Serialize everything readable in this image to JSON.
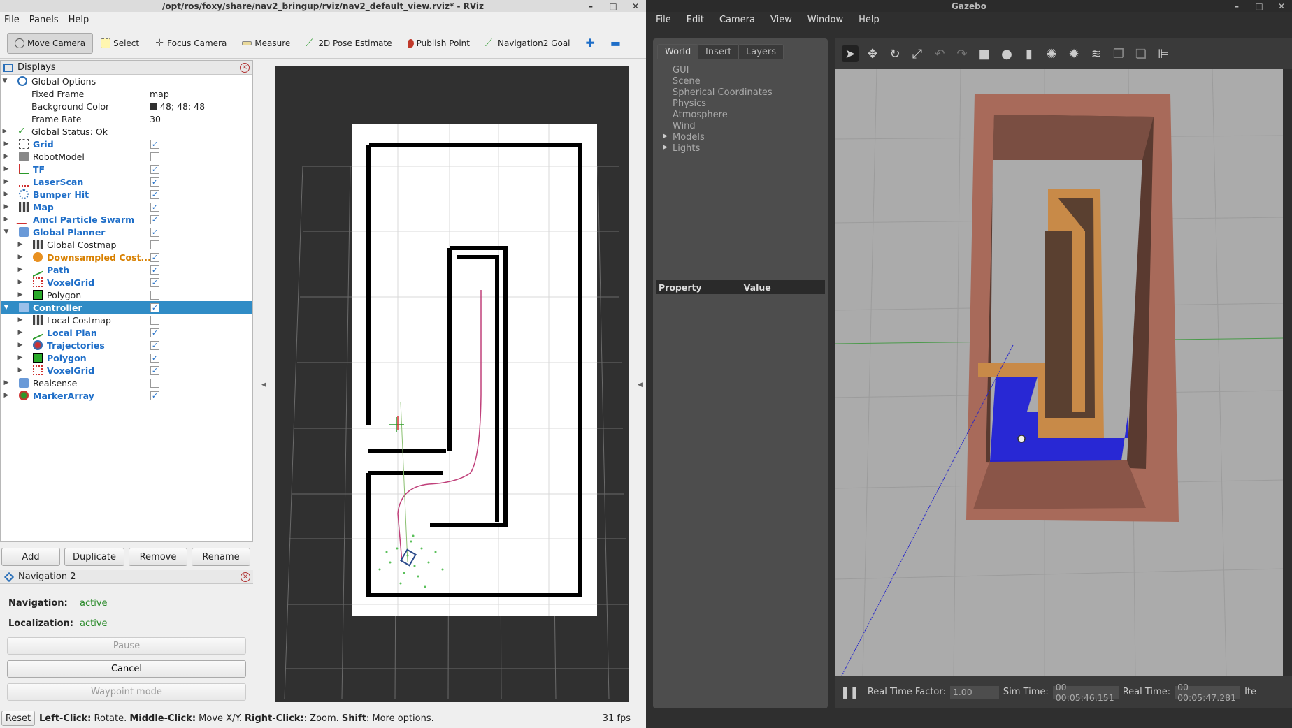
{
  "rviz": {
    "title": "/opt/ros/foxy/share/nav2_bringup/rviz/nav2_default_view.rviz* - RViz",
    "menu": [
      "File",
      "Panels",
      "Help"
    ],
    "toolbar": {
      "move_camera": "Move Camera",
      "select": "Select",
      "focus_camera": "Focus Camera",
      "measure": "Measure",
      "pose_estimate": "2D Pose Estimate",
      "publish_point": "Publish Point",
      "nav2_goal": "Navigation2 Goal"
    },
    "displays": {
      "title": "Displays",
      "global_options": "Global Options",
      "fixed_frame": {
        "label": "Fixed Frame",
        "value": "map"
      },
      "background_color": {
        "label": "Background Color",
        "value": "48; 48; 48"
      },
      "frame_rate": {
        "label": "Frame Rate",
        "value": "30"
      },
      "global_status": "Global Status: Ok",
      "items": [
        {
          "label": "Grid",
          "checked": true
        },
        {
          "label": "RobotModel",
          "checked": false
        },
        {
          "label": "TF",
          "checked": true
        },
        {
          "label": "LaserScan",
          "checked": true
        },
        {
          "label": "Bumper Hit",
          "checked": true
        },
        {
          "label": "Map",
          "checked": true
        },
        {
          "label": "Amcl Particle Swarm",
          "checked": true
        },
        {
          "label": "Global Planner",
          "checked": true
        },
        {
          "label": "Global Costmap",
          "checked": false
        },
        {
          "label": "Downsampled Cost...",
          "checked": true
        },
        {
          "label": "Path",
          "checked": true
        },
        {
          "label": "VoxelGrid",
          "checked": true
        },
        {
          "label": "Polygon",
          "checked": false
        },
        {
          "label": "Controller",
          "checked": true
        },
        {
          "label": "Local Costmap",
          "checked": false
        },
        {
          "label": "Local Plan",
          "checked": true
        },
        {
          "label": "Trajectories",
          "checked": true
        },
        {
          "label": "Polygon",
          "checked": true
        },
        {
          "label": "VoxelGrid",
          "checked": true
        },
        {
          "label": "Realsense",
          "checked": false
        },
        {
          "label": "MarkerArray",
          "checked": true
        }
      ],
      "buttons": [
        "Add",
        "Duplicate",
        "Remove",
        "Rename"
      ]
    },
    "navigation2": {
      "title": "Navigation 2",
      "navigation_label": "Navigation:",
      "navigation_value": "active",
      "localization_label": "Localization:",
      "localization_value": "active",
      "pause": "Pause",
      "cancel": "Cancel",
      "waypoint_mode": "Waypoint mode"
    },
    "status": {
      "reset": "Reset",
      "lc": "Left-Click:",
      "lc_t": " Rotate. ",
      "mc": "Middle-Click:",
      "mc_t": " Move X/Y. ",
      "rc": "Right-Click:",
      "rc_t": ": Zoom. ",
      "sh": "Shift",
      "sh_t": ": More options.",
      "fps": "31 fps"
    }
  },
  "gazebo": {
    "title": "Gazebo",
    "menu": [
      "File",
      "Edit",
      "Camera",
      "View",
      "Window",
      "Help"
    ],
    "tabs": [
      "World",
      "Insert",
      "Layers"
    ],
    "world_items": [
      "GUI",
      "Scene",
      "Spherical Coordinates",
      "Physics",
      "Atmosphere",
      "Wind",
      "Models",
      "Lights"
    ],
    "property_header": "Property",
    "value_header": "Value",
    "bottom": {
      "rtf_label": "Real Time Factor:",
      "rtf_value": "1.00",
      "sim_label": "Sim Time:",
      "sim_value": "00 00:05:46.151",
      "real_label": "Real Time:",
      "real_value": "00 00:05:47.281",
      "iter_label": "Ite"
    }
  },
  "colors": {
    "selection": "#308cc6",
    "rviz_background": "#303030",
    "gazebo_panel": "#4d4d4d",
    "active_green": "#2a8a2a"
  }
}
